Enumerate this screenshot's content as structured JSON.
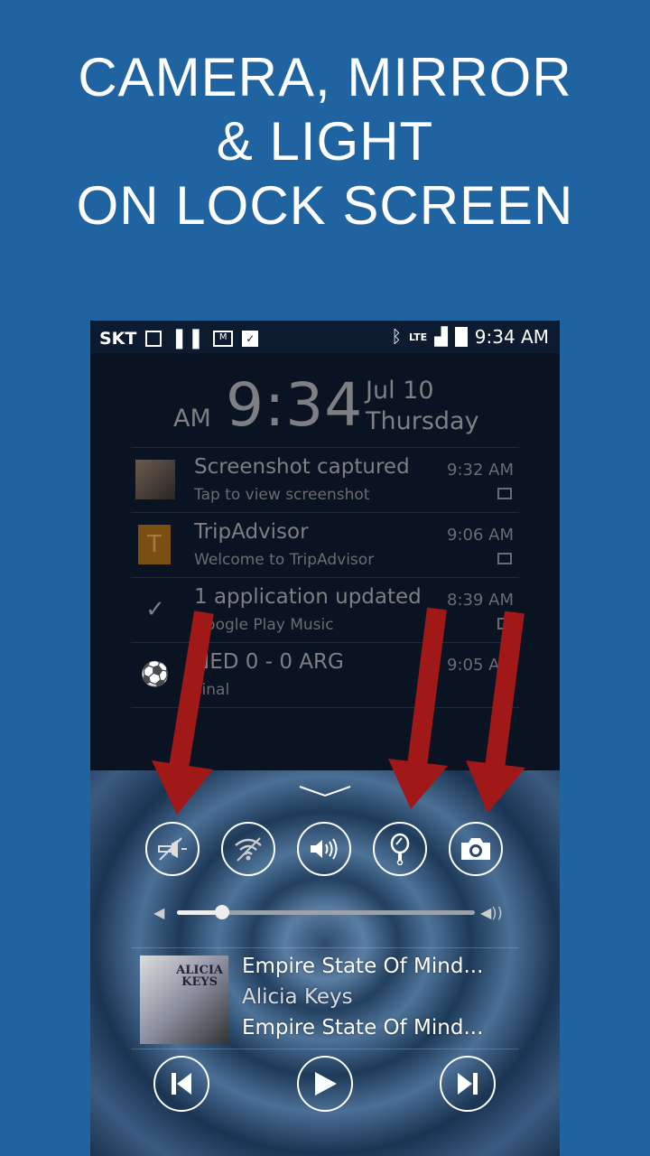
{
  "headline": {
    "line1": "CAMERA, MIRROR",
    "line2": "& LIGHT",
    "line3": "ON LOCK SCREEN"
  },
  "status_bar": {
    "carrier": "SKT",
    "network": "LTE",
    "time": "9:34 AM",
    "icons": [
      "image-icon",
      "pause-icon",
      "gmail-icon",
      "play-store-icon",
      "bluetooth-icon",
      "lte-icon",
      "signal-icon",
      "battery-icon"
    ]
  },
  "lock_clock": {
    "ampm": "AM",
    "time": "9:34",
    "date": "Jul 10",
    "day": "Thursday"
  },
  "notifications": [
    {
      "title": "Screenshot captured",
      "subtitle": "Tap to view screenshot",
      "time": "9:32 AM",
      "icon": "screenshot-thumbnail",
      "small_icon": "image-icon"
    },
    {
      "title": "TripAdvisor",
      "subtitle": "Welcome to TripAdvisor",
      "time": "9:06 AM",
      "icon": "T",
      "small_icon": "gmail-icon"
    },
    {
      "title": "1 application updated",
      "subtitle": "Google Play Music",
      "time": "8:39 AM",
      "icon": "play-store-icon",
      "small_icon": "play-store-icon"
    },
    {
      "title": "NED 0 - 0 ARG",
      "subtitle": "Final",
      "time": "9:05 AM",
      "icon": "soccer-ball-icon",
      "small_icon": ""
    }
  ],
  "quick_toggles": [
    {
      "name": "flashlight-off",
      "icon": "flashlight-off-icon"
    },
    {
      "name": "wifi-off",
      "icon": "wifi-off-icon"
    },
    {
      "name": "sound",
      "icon": "volume-icon"
    },
    {
      "name": "mirror",
      "icon": "mirror-icon"
    },
    {
      "name": "camera",
      "icon": "camera-icon"
    }
  ],
  "volume": {
    "level": 0.15
  },
  "music": {
    "title": "Empire State Of Mind...",
    "artist": "Alicia Keys",
    "album": "Empire State Of Mind...",
    "album_art_text": "ALICIA KEYS"
  },
  "colors": {
    "background": "#1f64a1",
    "arrow": "#a01818"
  }
}
